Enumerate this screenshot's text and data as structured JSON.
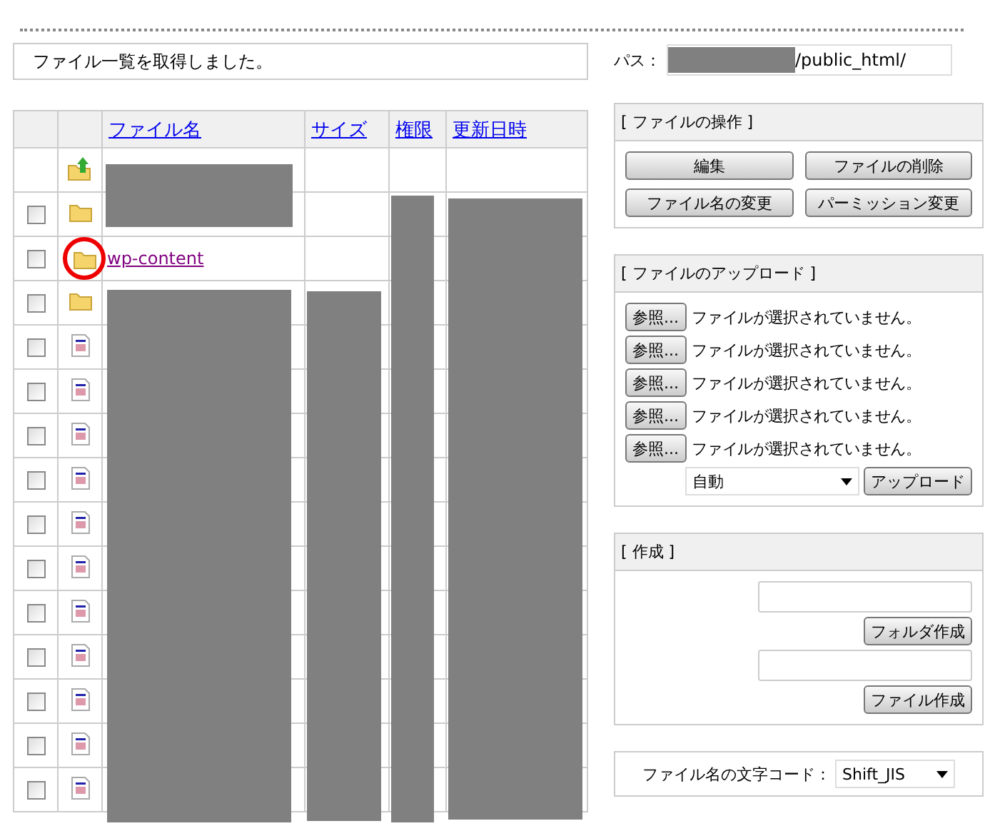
{
  "message": "ファイル一覧を取得しました。",
  "path": {
    "label": "パス：",
    "value": "/public_html/"
  },
  "table": {
    "columns": [
      "ファイル名",
      "サイズ",
      "権限",
      "更新日時"
    ],
    "rows": [
      {
        "kind": "parent"
      },
      {
        "kind": "folder",
        "checked": false
      },
      {
        "kind": "folder",
        "checked": false,
        "name": "wp-content",
        "highlighted": true
      },
      {
        "kind": "folder",
        "checked": false
      },
      {
        "kind": "file",
        "checked": false
      },
      {
        "kind": "file",
        "checked": false
      },
      {
        "kind": "file",
        "checked": false
      },
      {
        "kind": "file",
        "checked": false
      },
      {
        "kind": "file",
        "checked": false
      },
      {
        "kind": "file",
        "checked": false
      },
      {
        "kind": "file",
        "checked": false
      },
      {
        "kind": "file",
        "checked": false
      },
      {
        "kind": "file",
        "checked": false
      },
      {
        "kind": "file",
        "checked": false
      },
      {
        "kind": "file",
        "checked": false
      }
    ]
  },
  "operations": {
    "title": "[ ファイルの操作 ]",
    "buttons": [
      "編集",
      "ファイルの削除",
      "ファイル名の変更",
      "パーミッション変更"
    ]
  },
  "upload": {
    "title": "[ ファイルのアップロード ]",
    "files": [
      {
        "button": "参照...",
        "status": "ファイルが選択されていません。"
      },
      {
        "button": "参照...",
        "status": "ファイルが選択されていません。"
      },
      {
        "button": "参照...",
        "status": "ファイルが選択されていません。"
      },
      {
        "button": "参照...",
        "status": "ファイルが選択されていません。"
      },
      {
        "button": "参照...",
        "status": "ファイルが選択されていません。"
      }
    ],
    "mode": "自動",
    "submit": "アップロード"
  },
  "create": {
    "title": "[ 作成 ]",
    "folder_button": "フォルダ作成",
    "file_button": "ファイル作成"
  },
  "encoding": {
    "label": "ファイル名の文字コード：",
    "value": "Shift_JIS"
  }
}
